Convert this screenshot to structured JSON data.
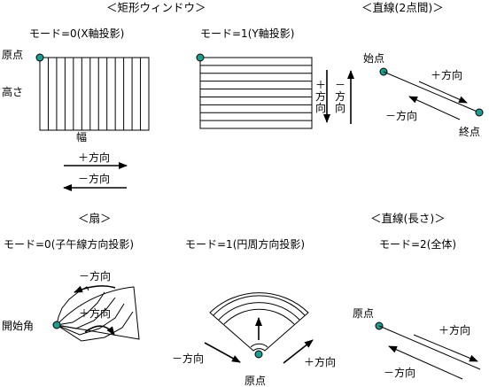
{
  "colors": {
    "origin_dot": "#1a9e8f",
    "line": "#000000",
    "background": "#ffffff"
  },
  "rect_window": {
    "heading": "＜矩形ウィンドウ＞",
    "mode0_label": "モード=0(X軸投影)",
    "mode1_label": "モード=1(Y軸投影)",
    "origin": "原点",
    "height": "高さ",
    "width": "幅",
    "plus_dir": "＋方向",
    "minus_dir": "－方向",
    "vert_plus": [
      "＋",
      "方",
      "向"
    ],
    "vert_minus": [
      "－",
      "方",
      "向"
    ]
  },
  "line_2pt": {
    "heading": "＜直線(2点間)＞",
    "start": "始点",
    "end": "終点",
    "plus_dir": "＋方向",
    "minus_dir": "－方向"
  },
  "fan": {
    "heading": "＜扇＞",
    "mode0_label": "モード=0(子午線方向投影)",
    "mode1_label": "モード=1(円周方向投影)",
    "start_angle": "開始角",
    "origin": "原点",
    "plus_dir": "＋方向",
    "minus_dir": "－方向",
    "minus_dir_2": "－方向",
    "plus_dir_2": "＋方向"
  },
  "line_len": {
    "heading": "＜直線(長さ)＞",
    "mode_label": "モード=2(全体)",
    "origin": "原点",
    "plus_dir": "＋方向",
    "minus_dir": "－方向"
  }
}
